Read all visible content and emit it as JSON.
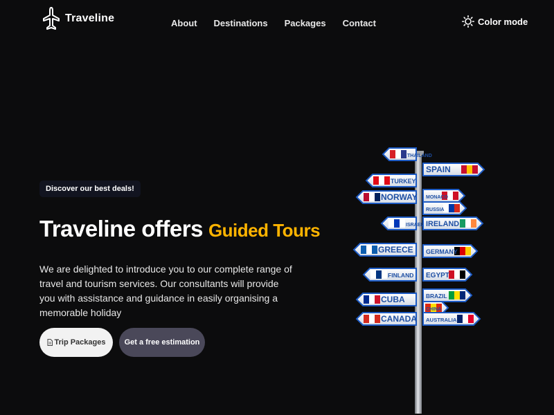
{
  "brand": {
    "name": "Traveline",
    "icon": "airplane-icon"
  },
  "nav": {
    "links": [
      "About",
      "Destinations",
      "Packages",
      "Contact"
    ],
    "color_mode_label": "Color mode",
    "color_mode_icon": "sun-icon"
  },
  "hero": {
    "pill": "Discover our best deals!",
    "headline_main": "Traveline offers",
    "headline_accent": "Guided Tours",
    "description": "We are delighted to introduce you to our complete range of travel and tourism services. Our consultants will provide you with assistance and guidance in easily organising a memorable holiday",
    "buttons": {
      "primary": "Trip Packages",
      "primary_icon": "document-icon",
      "secondary": "Get a free estimation"
    }
  },
  "signpost": {
    "signs": [
      "THAILAND",
      "SPAIN",
      "TURKEY",
      "NORWAY",
      "MONACO",
      "RUSSIA",
      "ISRAEL",
      "IRELAND",
      "GREECE",
      "GERMANY",
      "FINLAND",
      "EGYPT",
      "CUBA",
      "BRAZIL",
      "CHINA",
      "CANADA",
      "AUSTRALIA"
    ]
  },
  "colors": {
    "background": "#0c0c0d",
    "accent": "#ffb400",
    "secondary_button": "#4a4859",
    "sign_text": "#1e4fa3"
  }
}
